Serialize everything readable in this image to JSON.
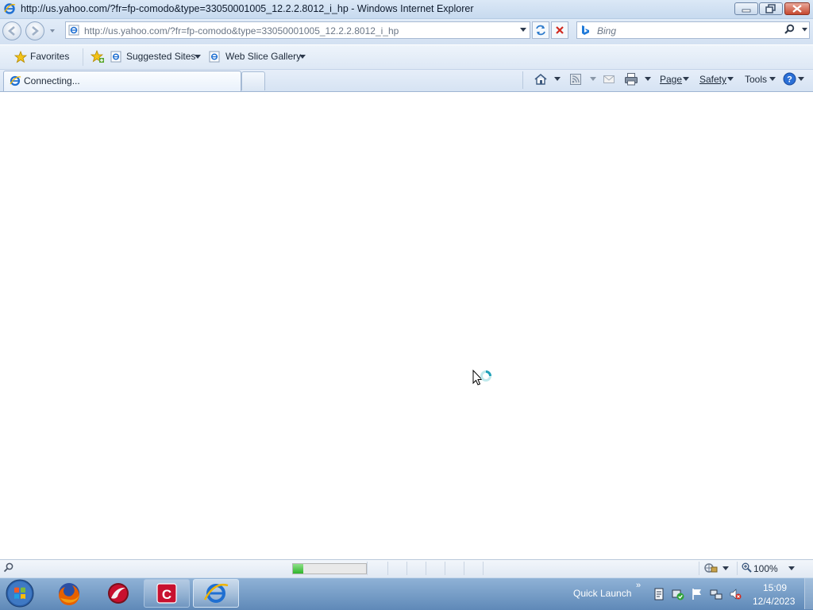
{
  "window": {
    "title": "http://us.yahoo.com/?fr=fp-comodo&type=33050001005_12.2.2.8012_i_hp - Windows Internet Explorer"
  },
  "address_bar": {
    "url": "http://us.yahoo.com/?fr=fp-comodo&type=33050001005_12.2.2.8012_i_hp"
  },
  "search_box": {
    "placeholder": "Bing"
  },
  "favorites_bar": {
    "favorites_label": "Favorites",
    "items": [
      {
        "label": "Suggested Sites"
      },
      {
        "label": "Web Slice Gallery"
      }
    ]
  },
  "tab": {
    "label": "Connecting..."
  },
  "command_bar": {
    "page": "Page",
    "safety": "Safety",
    "tools": "Tools"
  },
  "status_bar": {
    "progress": 0.14,
    "zoom": "100%"
  },
  "taskbar": {
    "quick_launch": "Quick Launch",
    "chevron": "»",
    "time": "15:09",
    "date": "12/4/2023"
  },
  "colors": {
    "ie_blue": "#1f6fd1",
    "firefox_orange": "#e66000",
    "comodo_red": "#c8102e",
    "progress_green": "#2fb52b"
  }
}
